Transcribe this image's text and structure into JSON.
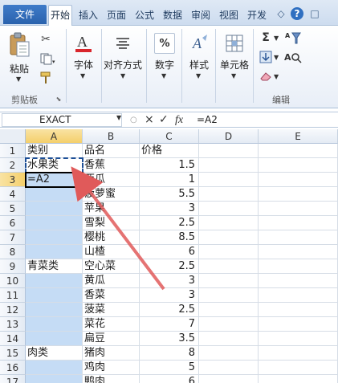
{
  "tabs": {
    "file": "文件",
    "items": [
      "开始",
      "插入",
      "页面",
      "公式",
      "数据",
      "审阅",
      "视图",
      "开发"
    ],
    "active": "开始",
    "controls": [
      "◇",
      "?",
      "□"
    ]
  },
  "ribbon": {
    "paste_label": "粘贴",
    "clipboard_group": "剪贴板",
    "font_label": "字体",
    "align_label": "对齐方式",
    "number_label": "数字",
    "style_label": "样式",
    "cells_label": "单元格",
    "edit_group": "编辑",
    "font_icon_text": "A",
    "number_icon_text": "%",
    "style_icon_text": "A",
    "sum_icon_text": "Σ",
    "sort_icon_text": "A"
  },
  "formula_bar": {
    "name_box": "EXACT",
    "cancel": "×",
    "confirm": "✓",
    "fx": "fx",
    "formula": "=A2"
  },
  "grid": {
    "columns": [
      "A",
      "B",
      "C",
      "D",
      "E"
    ],
    "rows": [
      "1",
      "2",
      "3",
      "4",
      "5",
      "6",
      "7",
      "8",
      "9",
      "10",
      "11",
      "12",
      "13",
      "14",
      "15",
      "16",
      "17"
    ],
    "cells": [
      [
        "类别",
        "品名",
        "价格"
      ],
      [
        "水果类",
        "香蕉",
        "1.5"
      ],
      [
        "=A2",
        "西瓜",
        "1"
      ],
      [
        "",
        "菠萝蜜",
        "5.5"
      ],
      [
        "",
        "苹果",
        "3"
      ],
      [
        "",
        "雪梨",
        "2.5"
      ],
      [
        "",
        "樱桃",
        "8.5"
      ],
      [
        "",
        "山楂",
        "6"
      ],
      [
        "青菜类",
        "空心菜",
        "2.5"
      ],
      [
        "",
        "黄瓜",
        "3"
      ],
      [
        "",
        "香菜",
        "3"
      ],
      [
        "",
        "菠菜",
        "2.5"
      ],
      [
        "",
        "菜花",
        "7"
      ],
      [
        "",
        "扁豆",
        "3.5"
      ],
      [
        "肉类",
        "猪肉",
        "8"
      ],
      [
        "",
        "鸡肉",
        "5"
      ],
      [
        "",
        "鸭肉",
        "6"
      ]
    ]
  },
  "colors": {
    "selected_fill": "#c5dcf5",
    "annotation_arrow": "#e05a5a",
    "file_tab": "#2f6cb8"
  }
}
